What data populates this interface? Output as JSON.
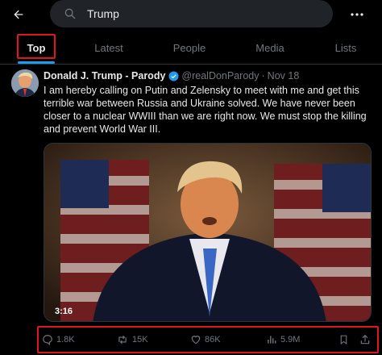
{
  "search": {
    "value": "Trump"
  },
  "tabs": [
    {
      "label": "Top"
    },
    {
      "label": "Latest"
    },
    {
      "label": "People"
    },
    {
      "label": "Media"
    },
    {
      "label": "Lists"
    }
  ],
  "tweet": {
    "author_name": "Donald J. Trump - Parody",
    "handle": "@realDonParody",
    "separator": "·",
    "date": "Nov 18",
    "text": "I am hereby calling on Putin and Zelensky to meet with me and get this terrible war between Russia and Ukraine solved. We have never been closer to a nuclear WWIII than we are right now. We must stop the killing and prevent World War III.",
    "video_duration": "3:16"
  },
  "actions": {
    "replies": "1.8K",
    "reposts": "15K",
    "likes": "86K",
    "views": "5.9M"
  },
  "colors": {
    "background": "#000000",
    "accent": "#1d9bf0",
    "highlight_box": "#e0141e",
    "muted_text": "#71767b"
  },
  "icons": [
    "back-arrow-icon",
    "search-icon",
    "more-icon",
    "verified-icon",
    "reply-icon",
    "repost-icon",
    "like-icon",
    "views-icon",
    "bookmark-icon",
    "share-icon"
  ]
}
